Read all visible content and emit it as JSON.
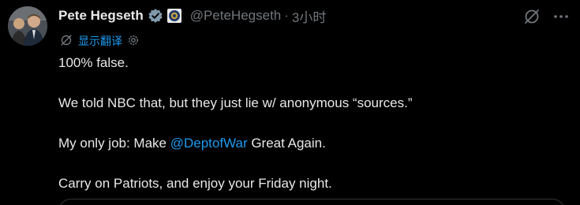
{
  "author": {
    "name": "Pete Hegseth",
    "handle": "@PeteHegseth",
    "separator": "·",
    "time": "3小时"
  },
  "icons": {
    "verified": "verified-badge-icon",
    "affiliation": "government-seal-icon",
    "grok": "grok-icon",
    "more": "more-options-icon",
    "translate_grok": "grok-translate-icon",
    "settings": "gear-icon"
  },
  "translate": {
    "label": "显示翻译"
  },
  "tweet": {
    "line1": "100% false.",
    "line2": "We told NBC that, but they just lie w/ anonymous “sources.”",
    "line3_before": "My only job: Make ",
    "line3_mention": "@DeptofWar",
    "line3_after": " Great Again.",
    "line4": "Carry on Patriots, and enjoy your Friday night."
  },
  "colors": {
    "background": "#000000",
    "text": "#e7e9ea",
    "secondary": "#71767b",
    "accent": "#1d9bf0",
    "verified": "#829aab"
  }
}
